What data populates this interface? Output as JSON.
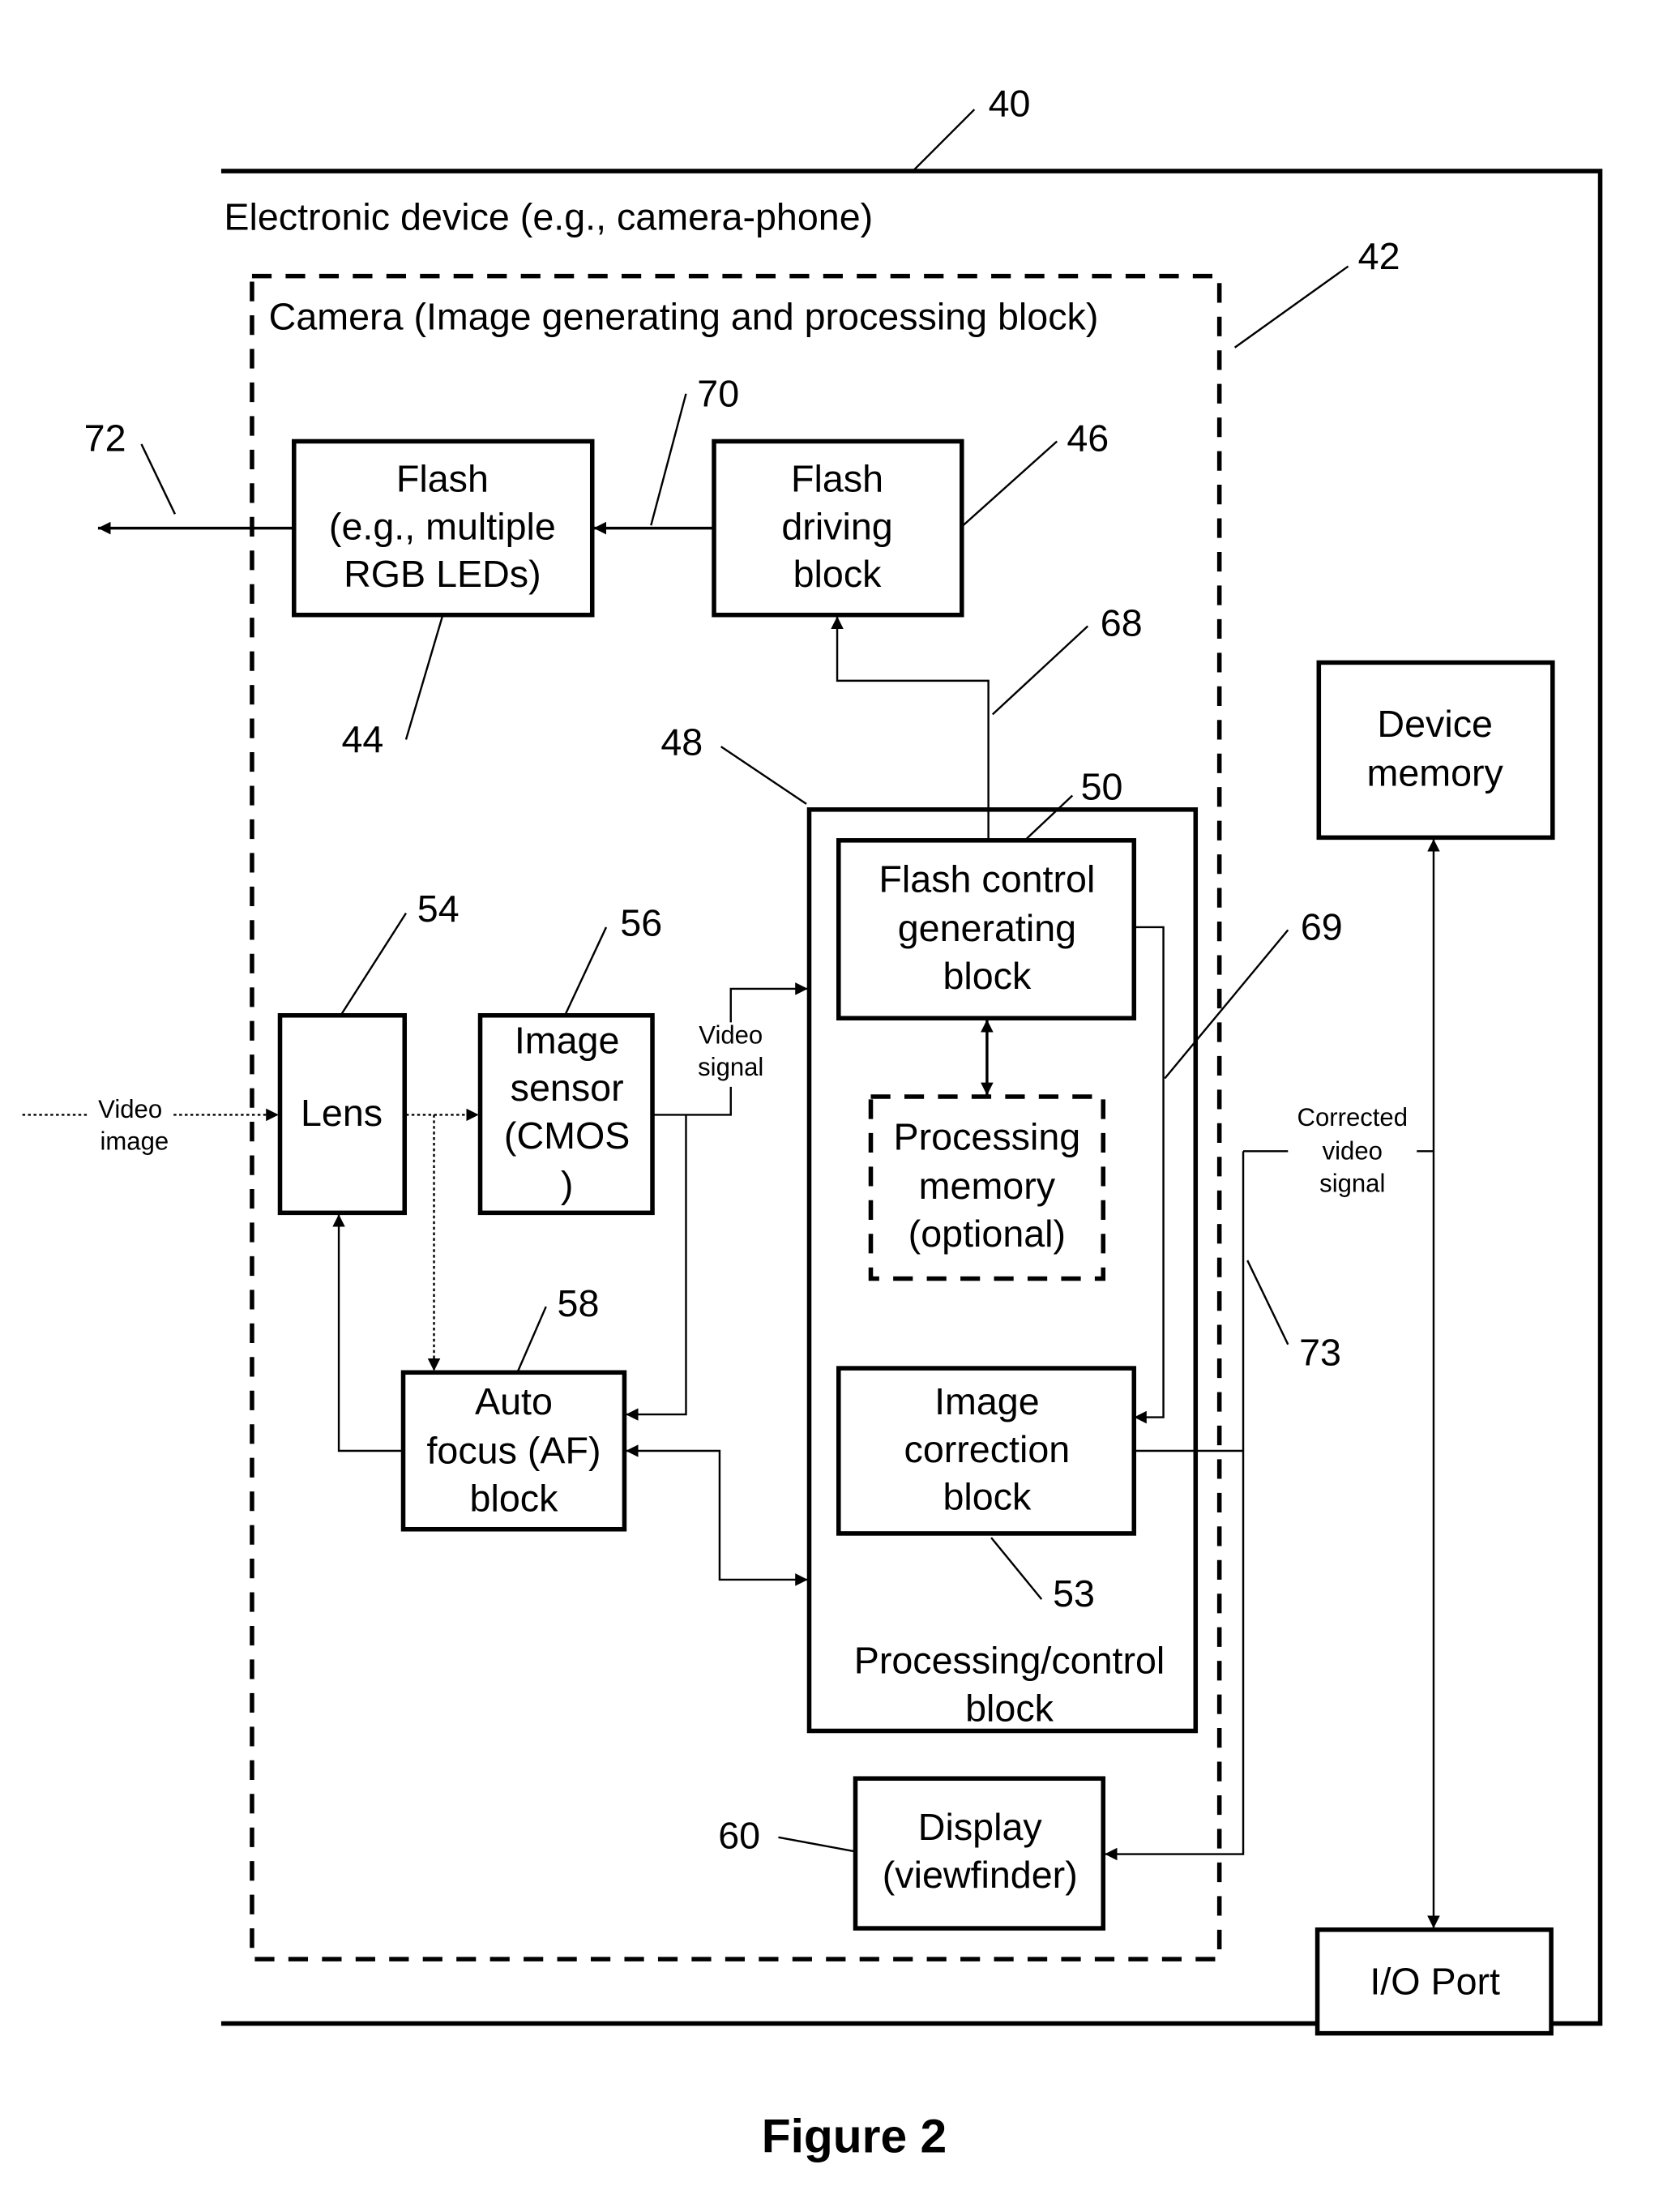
{
  "figure": {
    "caption": "Figure 2",
    "device_label": "Electronic device (e.g., camera-phone)",
    "camera_label": "Camera (Image generating and processing block)",
    "blocks": {
      "flash": [
        "Flash",
        "(e.g., multiple",
        "RGB LEDs)"
      ],
      "flash_driving": [
        "Flash",
        "driving",
        "block"
      ],
      "device_memory": [
        "Device",
        "memory"
      ],
      "flash_control": [
        "Flash control",
        "generating",
        "block"
      ],
      "processing_memory": [
        "Processing",
        "memory",
        "(optional)"
      ],
      "lens": [
        "Lens"
      ],
      "image_sensor": [
        "Image",
        "sensor",
        "(CMOS",
        ")"
      ],
      "auto_focus": [
        "Auto",
        "focus (AF)",
        "block"
      ],
      "image_correction": [
        "Image",
        "correction",
        "block"
      ],
      "processing_control": [
        "Processing/control",
        "block"
      ],
      "display": [
        "Display",
        "(viewfinder)"
      ],
      "io_port": [
        "I/O Port"
      ]
    },
    "signals": {
      "video_image": [
        "Video",
        "image"
      ],
      "video_signal": [
        "Video",
        "signal"
      ],
      "corrected_video_signal": [
        "Corrected",
        "video",
        "signal"
      ]
    },
    "refs": {
      "r40": "40",
      "r42": "42",
      "r44": "44",
      "r46": "46",
      "r48": "48",
      "r50": "50",
      "r53": "53",
      "r54": "54",
      "r56": "56",
      "r58": "58",
      "r60": "60",
      "r68": "68",
      "r69": "69",
      "r70": "70",
      "r72": "72",
      "r73": "73"
    }
  }
}
